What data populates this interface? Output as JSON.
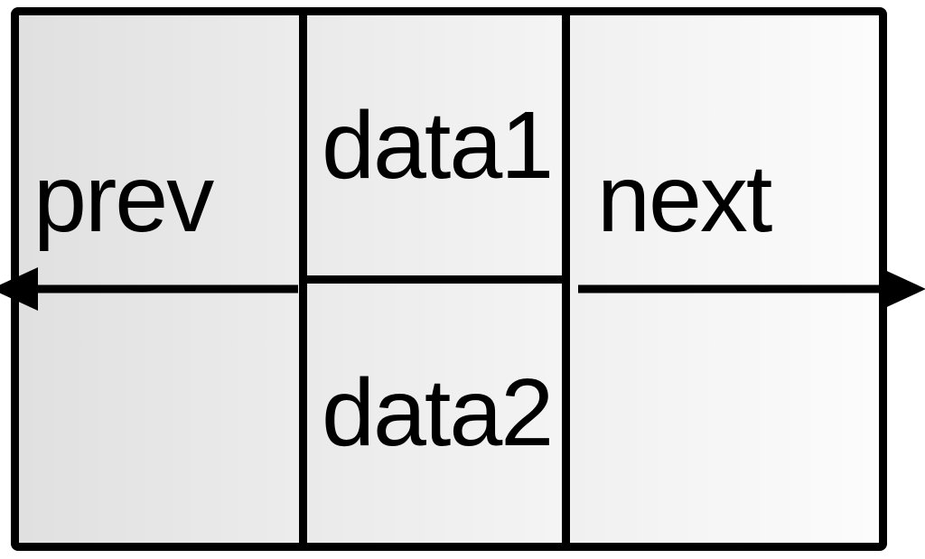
{
  "node": {
    "prev_label": "prev",
    "next_label": "next",
    "data1_label": "data1",
    "data2_label": "data2"
  }
}
